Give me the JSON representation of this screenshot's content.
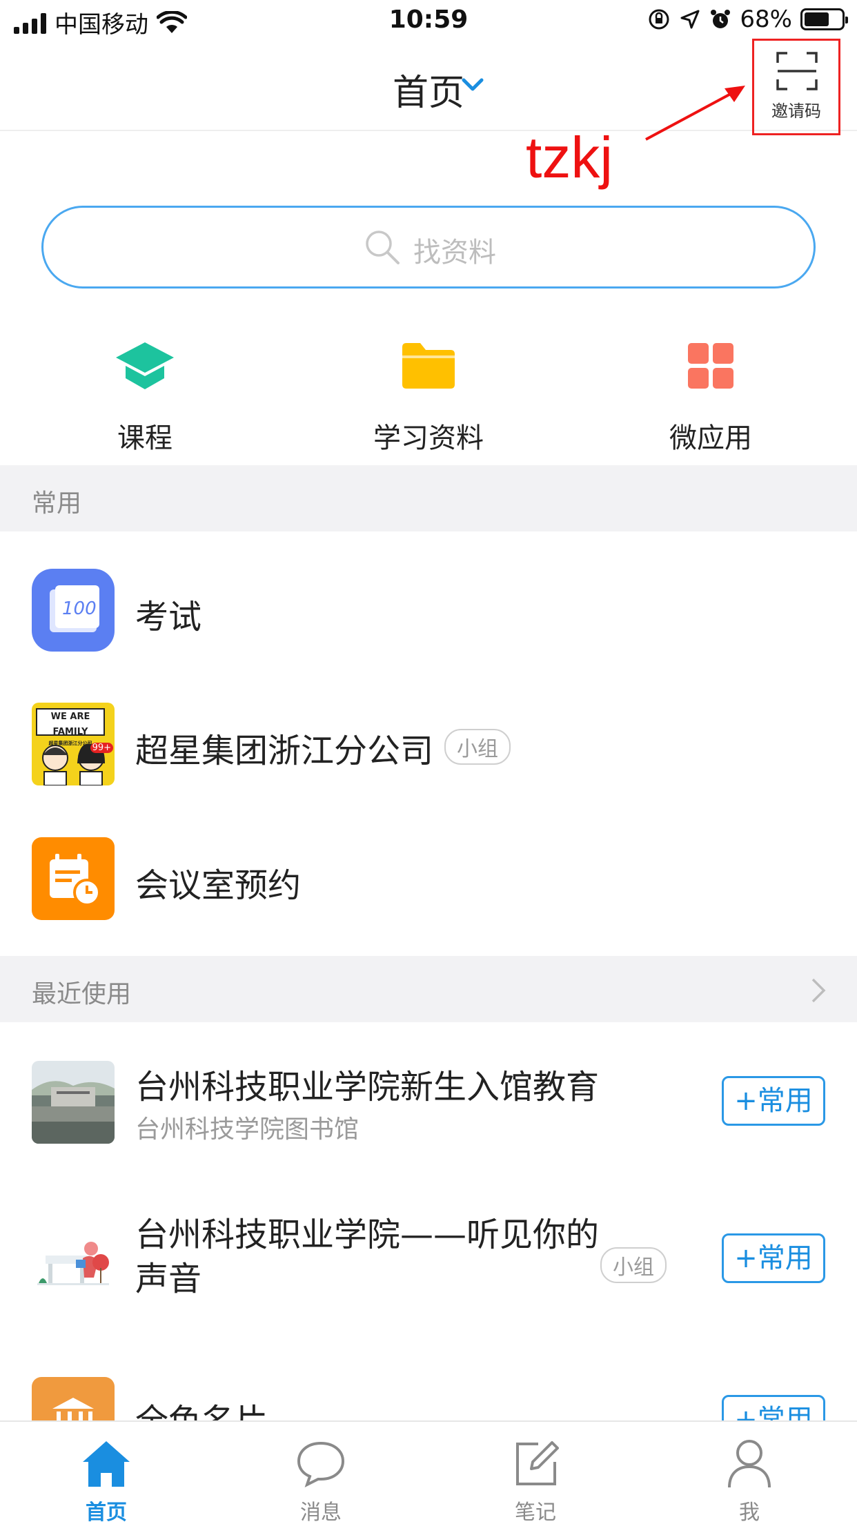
{
  "status_bar": {
    "carrier": "中国移动",
    "time": "10:59",
    "battery": "68%"
  },
  "nav": {
    "title": "首页",
    "invite_label": "邀请码"
  },
  "annotation": {
    "text": "tzkj",
    "color": "#ee1111"
  },
  "search": {
    "placeholder": "找资料"
  },
  "quick_entries": [
    {
      "label": "课程",
      "icon": "graduation-cap-icon",
      "color": "#1dc39e"
    },
    {
      "label": "学习资料",
      "icon": "folder-icon",
      "color": "#ffc000"
    },
    {
      "label": "微应用",
      "icon": "grid-apps-icon",
      "color": "#fa7560"
    }
  ],
  "sections": {
    "frequent": "常用",
    "recent": "最近使用"
  },
  "frequent_items": [
    {
      "title": "考试",
      "icon": "exam-100-icon"
    },
    {
      "title": "超星集团浙江分公司",
      "tag": "小组",
      "icon_text": "WE ARE FAMILY",
      "icon_sub": "超星集团浙江分公司",
      "badge": "99+"
    },
    {
      "title": "会议室预约",
      "icon": "calendar-clock-icon"
    }
  ],
  "recent_items": [
    {
      "title": "台州科技职业学院新生入馆教育",
      "subtitle": "台州科技学院图书馆",
      "button": "+常用"
    },
    {
      "title_line1": "台州科技职业学院——听见你的",
      "title_line2": "声音",
      "tag": "小组",
      "button": "+常用"
    },
    {
      "title": "全色名片",
      "button": "+常用"
    }
  ],
  "tabs": [
    {
      "label": "首页",
      "icon": "home-icon",
      "active": true
    },
    {
      "label": "消息",
      "icon": "chat-bubble-icon",
      "active": false
    },
    {
      "label": "笔记",
      "icon": "note-edit-icon",
      "active": false
    },
    {
      "label": "我",
      "icon": "person-icon",
      "active": false
    }
  ],
  "colors": {
    "accent": "#1a8ee0",
    "search_border": "#4aa8f0",
    "section_bg": "#f2f2f4"
  }
}
